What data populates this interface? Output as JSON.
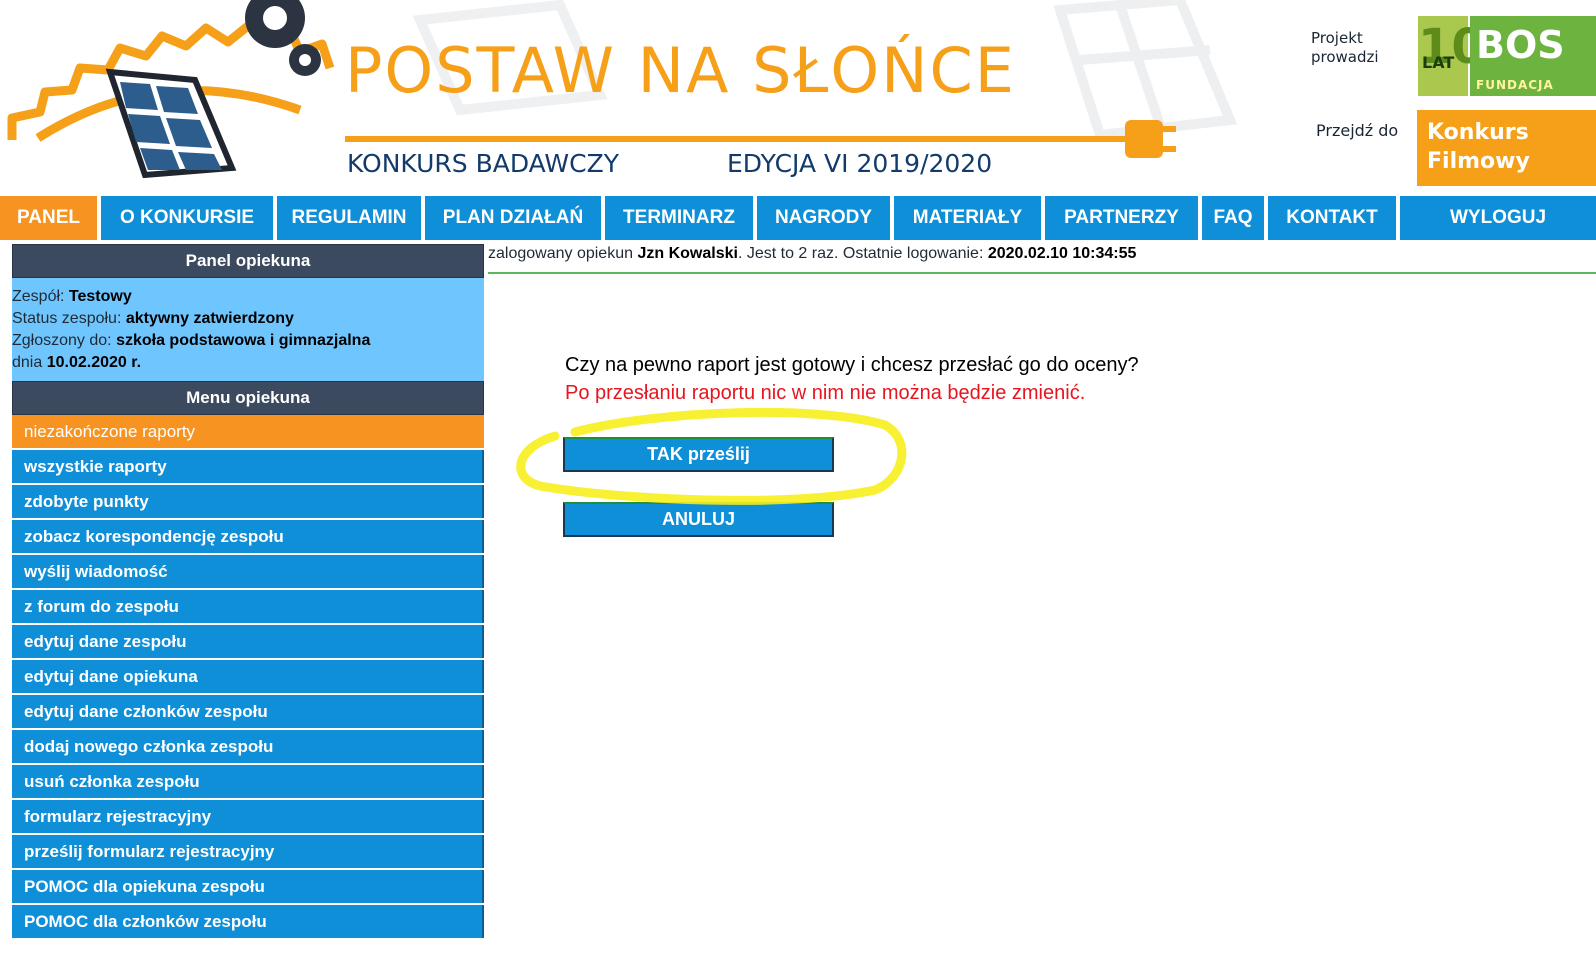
{
  "header": {
    "title": "POSTAW NA SŁOŃCE",
    "subtitle_left": "KONKURS BADAWCZY",
    "subtitle_right": "EDYCJA VI  2019/2020",
    "project_label": "Projekt prowadzi",
    "logo_number": "10",
    "logo_lat": "LAT",
    "logo_name": "BOS",
    "logo_fund": "FUNDACJA",
    "goto_label": "Przejdź do",
    "film_link_line1": "Konkurs",
    "film_link_line2": "Filmowy"
  },
  "nav": {
    "items": [
      "PANEL",
      "O KONKURSIE",
      "REGULAMIN",
      "PLAN DZIAŁAŃ",
      "TERMINARZ",
      "NAGRODY",
      "MATERIAŁY",
      "PARTNERZY",
      "FAQ",
      "KONTAKT",
      "WYLOGUJ"
    ],
    "active": "PANEL"
  },
  "sidebar": {
    "panel_title": "Panel opiekuna",
    "team_label": "Zespół:",
    "team_value": "Testowy",
    "status_label": "Status zespołu:",
    "status_value": "aktywny zatwierdzony",
    "registered_label": "Zgłoszony do:",
    "registered_value": "szkoła podstawowa i gimnazjalna",
    "date_prefix": "dnia",
    "date_value": "10.02.2020 r.",
    "menu_title": "Menu opiekuna",
    "menu_items": [
      "niezakończone raporty",
      "wszystkie raporty",
      "zdobyte punkty",
      "zobacz korespondencję zespołu",
      "wyślij wiadomość",
      "z forum do zespołu",
      "edytuj dane zespołu",
      "edytuj dane opiekuna",
      "edytuj dane członków zespołu",
      "dodaj nowego członka zespołu",
      "usuń członka zespołu",
      "formularz rejestracyjny",
      "prześlij formularz rejestracyjny",
      "POMOC dla opiekuna zespołu",
      "POMOC dla członków zespołu"
    ]
  },
  "login_info": {
    "prefix": "zalogowany opiekun",
    "user": "Jzn Kowalski",
    "middle": ". Jest to 2 raz. Ostatnie logowanie:",
    "last_login": "2020.02.10 10:34:55"
  },
  "confirm": {
    "question": "Czy na pewno raport jest gotowy i chcesz przesłać go do oceny?",
    "warning": "Po przesłaniu raportu nic w nim nie można będzie zmienić.",
    "yes_button": "TAK prześlij",
    "cancel_button": "ANULUJ"
  },
  "colors": {
    "nav_blue": "#0f8fd8",
    "nav_active_orange": "#f79421",
    "panel_dark": "#3b4a5e",
    "team_info_bg": "#6fc6ff",
    "warning_red": "#e8141e",
    "highlight_yellow": "#f7ee1c",
    "title_orange": "#f6a01a",
    "subtitle_navy": "#123a6b"
  },
  "icons": [
    "sun-gear-logo-icon",
    "gear-icon",
    "solar-panel-icon",
    "power-plug-icon",
    "film-camera-icon"
  ]
}
